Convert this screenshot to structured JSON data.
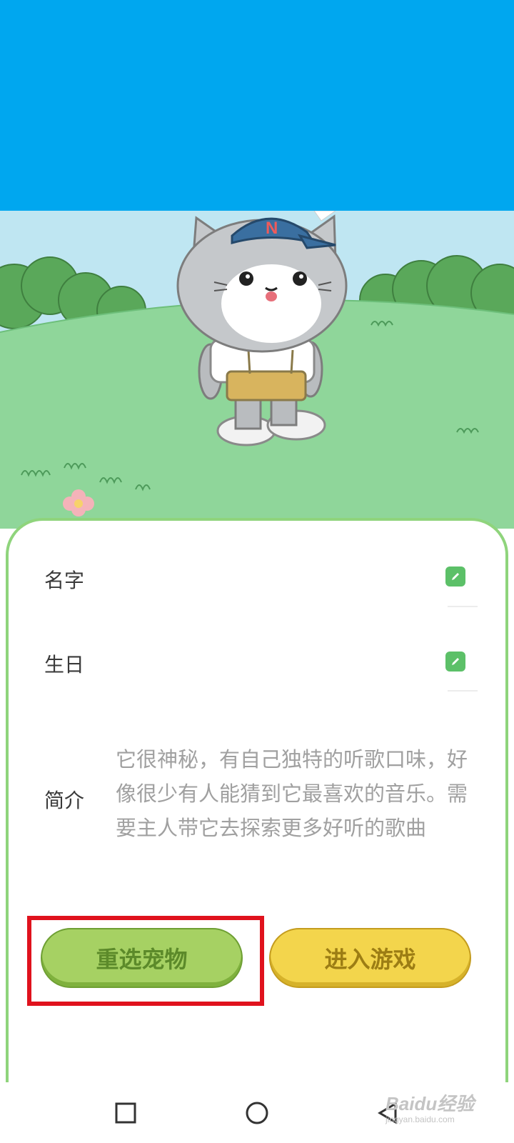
{
  "profile": {
    "name_label": "名字",
    "birthday_label": "生日",
    "intro_label": "简介",
    "intro_text": "它很神秘，有自己独特的听歌口味，好像很少有人能猜到它最喜欢的音乐。需要主人带它去探索更多好听的歌曲"
  },
  "buttons": {
    "reselect": "重选宠物",
    "enter_game": "进入游戏"
  },
  "pet": {
    "cap_letter": "N"
  },
  "icons": {
    "edit": "pencil-icon",
    "nav_recent": "square-icon",
    "nav_home": "circle-icon",
    "nav_back": "triangle-back-icon"
  },
  "watermark": {
    "main": "Baidu经验",
    "sub": "jingyan.baidu.com"
  },
  "colors": {
    "banner": "#00a7ef",
    "accent_green": "#5cc068",
    "reselect_button": "#a6d163",
    "enter_button": "#f3d54c",
    "highlight": "#e0121d"
  }
}
